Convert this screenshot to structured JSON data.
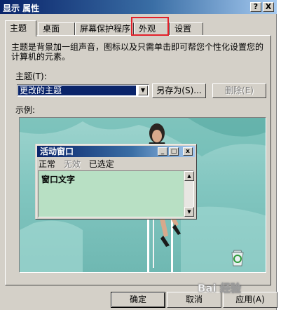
{
  "window": {
    "title": "显示 属性",
    "help_btn": "?",
    "close_btn": "X"
  },
  "tabs": [
    {
      "label": "主题"
    },
    {
      "label": "桌面"
    },
    {
      "label": "屏幕保护程序"
    },
    {
      "label": "外观"
    },
    {
      "label": "设置"
    }
  ],
  "theme": {
    "description": "主题是背景加一组声音，图标以及只需单击即可帮您个性化设置您的计算机的元素。",
    "label": "主题(T):",
    "selected": "更改的主题",
    "save_as": "另存为(S)...",
    "delete": "删除(E)"
  },
  "preview": {
    "label": "示例:",
    "window_title": "活动窗口",
    "menu": [
      "正常",
      "无效",
      "已选定"
    ],
    "client_text": "窗口文字"
  },
  "footer": {
    "ok": "确定",
    "cancel": "取消",
    "apply": "应用(A)"
  },
  "watermark": "Bai 经验",
  "colors": {
    "face": "#d4d0c8",
    "titlebar": "#0a246a",
    "highlight_box": "#e3202a",
    "desktop": "#8fcbc4",
    "window_client": "#b8e0c4"
  }
}
